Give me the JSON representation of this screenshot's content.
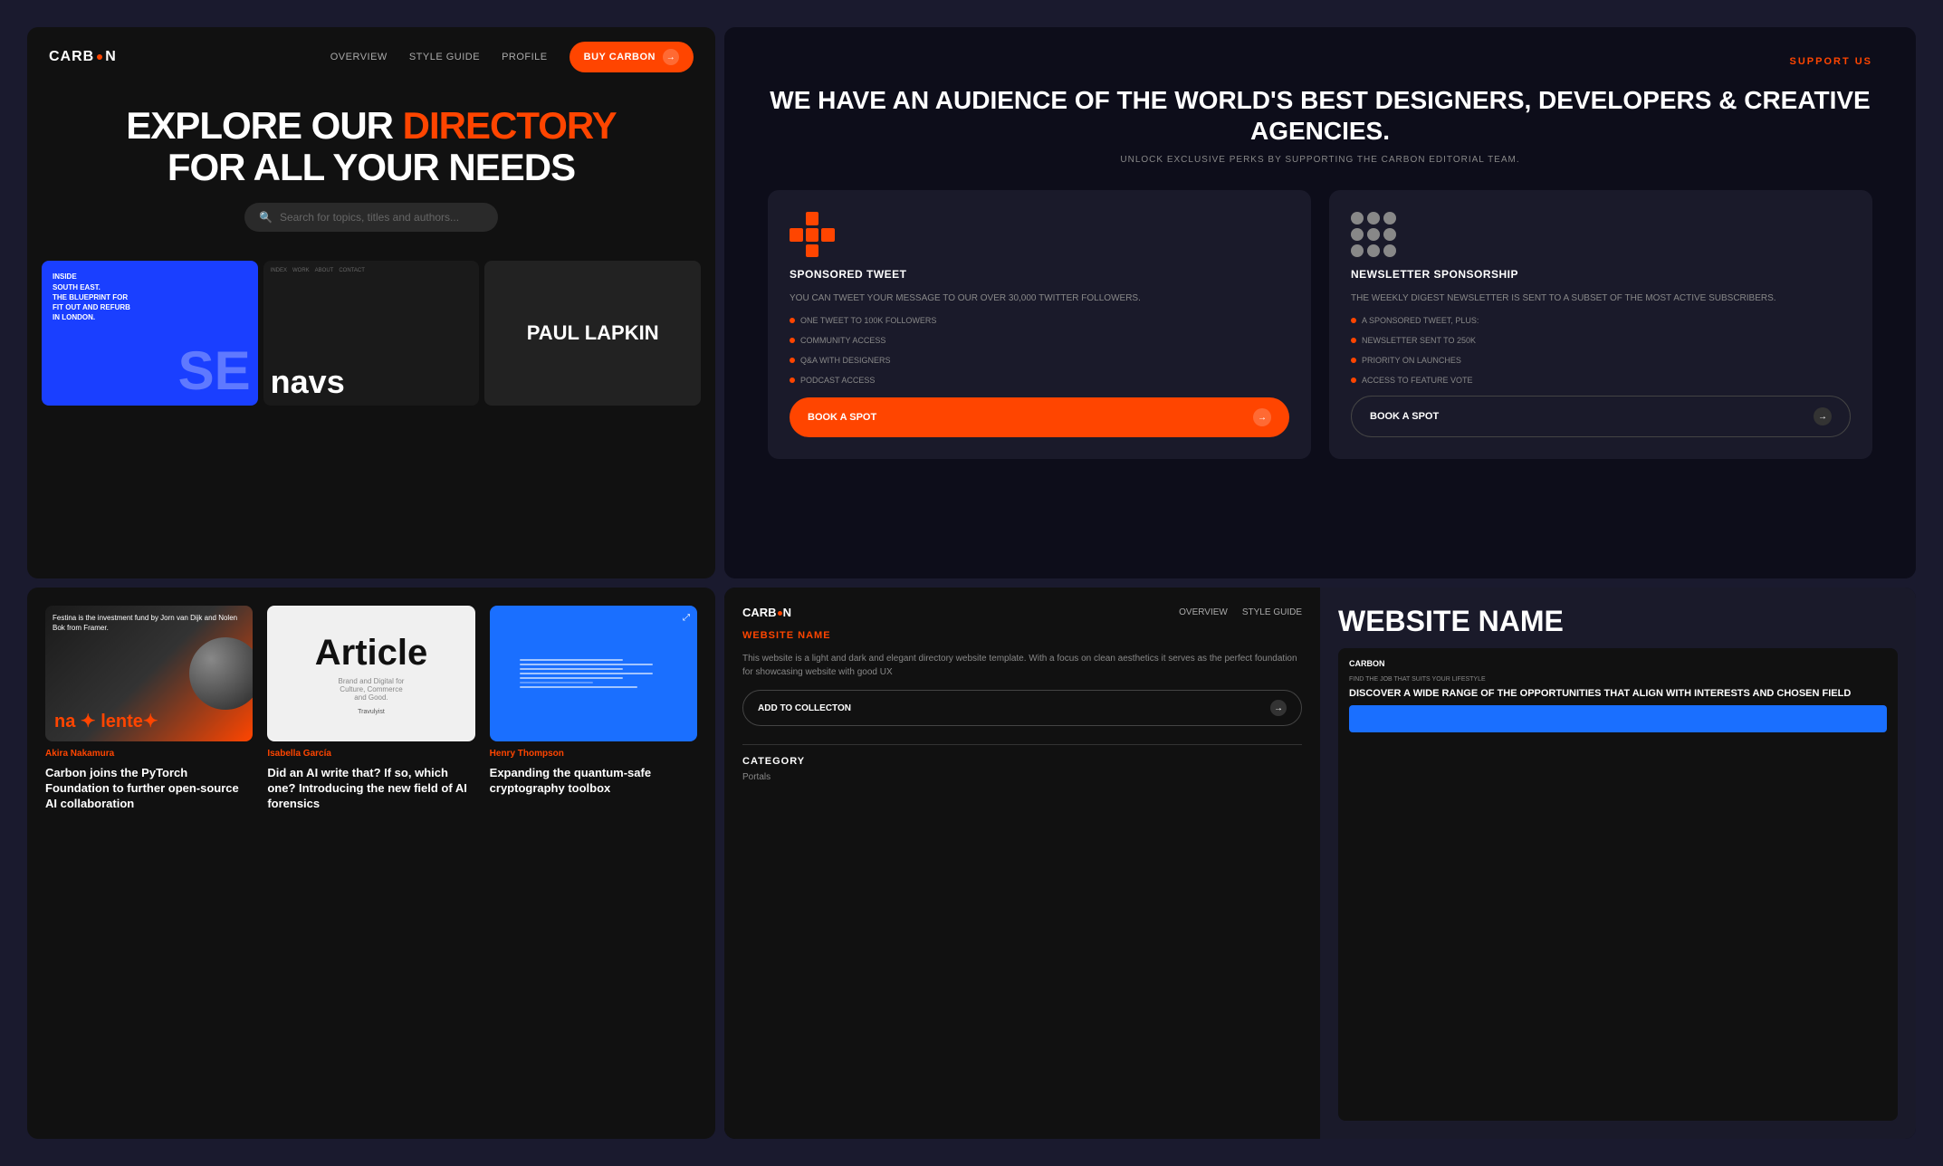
{
  "topLeft": {
    "logo": "CARB●N",
    "nav": {
      "overview": "OVERVIEW",
      "styleGuide": "STYLE GUIDE",
      "profile": "PROFILE",
      "buyButton": "BUY CARBON"
    },
    "hero": {
      "line1_prefix": "EXPLORE OUR ",
      "line1_accent": "DIRECTORY",
      "line2": "FOR ALL YOUR NEEDS"
    },
    "search": {
      "placeholder": "Search for topics, titles and authors..."
    },
    "cards": [
      {
        "type": "blueprint",
        "topText": "INSIDE\nSOUTH EAST.\nTHE BLUEPRINT FOR\nFIT OUT AND REFURB\nIN LONDON.",
        "letter": "SE"
      },
      {
        "type": "navs",
        "brand": "navs",
        "navItems": [
          "INDEX",
          "WORK",
          "ABOUT",
          "CONTACT"
        ]
      },
      {
        "type": "paul",
        "name": "PAUL\nLAPKIN"
      }
    ]
  },
  "bottomLeft": {
    "posts": [
      {
        "author": "Akira Nakamura",
        "title": "Carbon joins the PyTorch Foundation to further open-source AI collaboration",
        "imgType": "festina"
      },
      {
        "author": "Isabella García",
        "title": "Did an AI write that? If so, which one? Introducing the new field of AI forensics",
        "imgType": "article"
      },
      {
        "author": "Henry Thompson",
        "title": "Expanding the quantum-safe cryptography toolbox",
        "imgType": "quantum"
      }
    ]
  },
  "topRight": {
    "supportLabel": "SUPPORT US",
    "title": "WE HAVE AN AUDIENCE OF THE WORLD'S BEST DESIGNERS, DEVELOPERS & CREATIVE AGENCIES.",
    "subtitle": "UNLOCK EXCLUSIVE PERKS BY SUPPORTING THE CARBON EDITORIAL TEAM.",
    "cards": [
      {
        "type": "tweet",
        "title": "SPONSORED TWEET",
        "desc": "YOU CAN TWEET YOUR MESSAGE TO OUR OVER 30,000 TWITTER FOLLOWERS.",
        "features": [
          "ONE TWEET TO 100K FOLLOWERS",
          "COMMUNITY ACCESS",
          "Q&A WITH DESIGNERS",
          "PODCAST ACCESS"
        ],
        "button": "BOOK A SPOT"
      },
      {
        "type": "newsletter",
        "title": "NEWSLETTER SPONSORSHIP",
        "desc": "THE WEEKLY DIGEST NEWSLETTER IS SENT TO A SUBSET OF THE MOST ACTIVE SUBSCRIBERS.",
        "features": [
          "A SPONSORED TWEET, PLUS:",
          "NEWSLETTER SENT TO 250K",
          "PRIORITY ON LAUNCHES",
          "ACCESS TO FEATURE VOTE"
        ],
        "button": "BOOK A SPOT"
      }
    ]
  },
  "bottomRight": {
    "logo": "CARB●N",
    "navLinks": [
      "OVERVIEW",
      "STYLE GUIDE"
    ],
    "websiteNameLabel": "WEBSITE NAME",
    "websiteNameTitle": "WEBSITE NAME",
    "desc": "This website is a light and dark and elegant directory website template. With a focus on clean aesthetics it serves as the perfect foundation for showcasing website with good UX",
    "addButton": "ADD TO COLLECTON",
    "categoryLabel": "CATEGORY",
    "categoryValue": "Portals",
    "miniPreviewLogo": "CARBON",
    "miniPreviewText": "FIND THE JOB THAT SUITS YOUR LIFESTYLE",
    "miniPreviewTitle": "DISCOVER A WIDE RANGE OF THE OPPORTUNITIES THAT ALIGN WITH INTERESTS AND CHOSEN FIELD"
  }
}
